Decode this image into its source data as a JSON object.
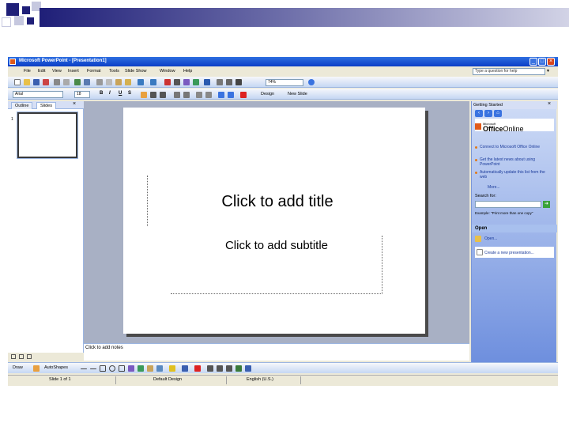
{
  "window": {
    "title": "Microsoft PowerPoint - [Presentation1]"
  },
  "menu": {
    "items": [
      "File",
      "Edit",
      "View",
      "Insert",
      "Format",
      "Tools",
      "Slide Show",
      "Window",
      "Help"
    ]
  },
  "ask_box": {
    "placeholder": "Type a question for help"
  },
  "toolbar": {
    "zoom": "74%",
    "font": "Arial",
    "size": "18",
    "bold": "B",
    "italic": "I",
    "underline": "U",
    "shadow": "S",
    "design": "Design",
    "new_slide": "New Slide"
  },
  "left_pane": {
    "tabs": [
      "Outline",
      "Slides"
    ],
    "active_tab": "Slides",
    "slide_number": "1"
  },
  "slide": {
    "title_placeholder": "Click to add title",
    "subtitle_placeholder": "Click to add subtitle"
  },
  "notes": {
    "placeholder": "Click to add notes"
  },
  "task_pane": {
    "title": "Getting Started",
    "logo_prefix": "Microsoft",
    "logo_office": "Office",
    "logo_online": "Online",
    "links": [
      "Connect to Microsoft Office Online",
      "Get the latest news about using PowerPoint",
      "Automatically update this list from the web"
    ],
    "more": "More...",
    "search_label": "Search for:",
    "search_example": "Example: \"Print more than one copy\"",
    "open_section": "Open",
    "open_link": "Open...",
    "create_link": "Create a new presentation..."
  },
  "drawing_toolbar": {
    "draw": "Draw",
    "autoshapes": "AutoShapes"
  },
  "status_bar": {
    "slide": "Slide 1 of 1",
    "design": "Default Design",
    "language": "English (U.S.)"
  },
  "colors": {
    "navy": "#1f1f78",
    "xp_blue": "#0a3ec6",
    "workarea": "#a8b0c4"
  }
}
